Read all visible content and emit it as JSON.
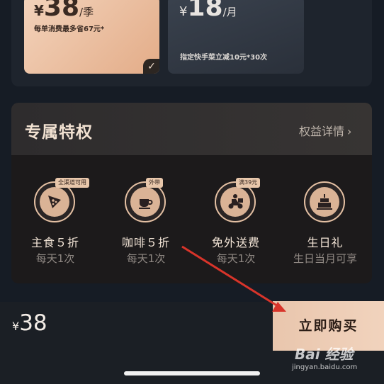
{
  "plans": [
    {
      "yen": "¥",
      "amount": "38",
      "unit": "/季",
      "desc": "每单消费最多省67元*",
      "selected": true
    },
    {
      "yen": "¥",
      "amount": "18",
      "unit": "/月",
      "desc": "指定快手菜立减10元*30次",
      "selected": false
    }
  ],
  "benefits": {
    "title": "专属特权",
    "details_link": "权益详情",
    "items": [
      {
        "tag": "全渠道可用",
        "title": "主食５折",
        "sub": "每天1次",
        "icon": "pizza-icon"
      },
      {
        "tag": "外带",
        "title": "咖啡５折",
        "sub": "每天1次",
        "icon": "coffee-cup-icon"
      },
      {
        "tag": "满39元",
        "title": "免外送费",
        "sub": "每天1次",
        "icon": "delivery-scooter-icon"
      },
      {
        "tag": "",
        "title": "生日礼",
        "sub": "生日当月可享",
        "icon": "birthday-cake-icon"
      }
    ]
  },
  "footer": {
    "yen": "¥",
    "total": "38",
    "buy_label": "立即购买"
  },
  "watermark": {
    "line1": "Bai 经验",
    "line2": "jingyan.baidu.com"
  },
  "colors": {
    "accent": "#e8c7ab",
    "annotation_arrow": "#d8342a",
    "background": "#161c25"
  }
}
